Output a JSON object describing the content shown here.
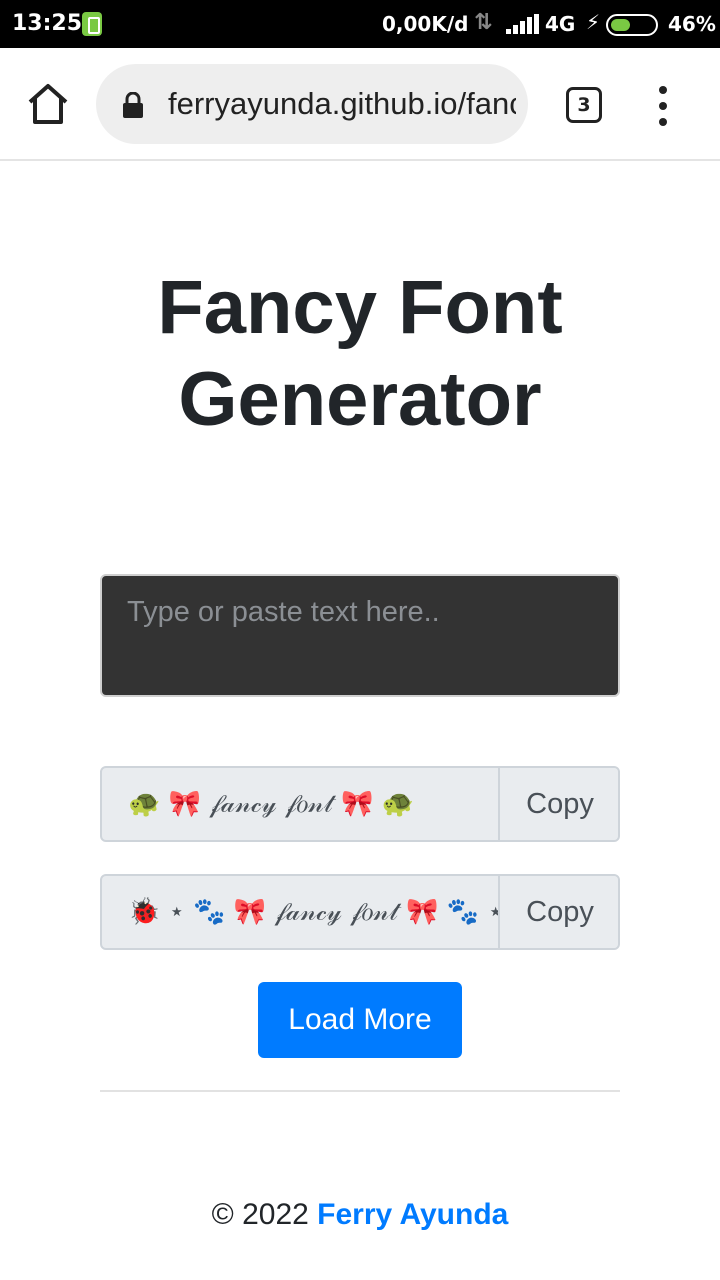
{
  "status_bar": {
    "time": "13:25",
    "net_speed": "0,00K/d",
    "network_type": "4G",
    "battery_percent": "46%",
    "battery_level": 0.46
  },
  "browser": {
    "url": "ferryayunda.github.io/fancy-font-generator",
    "tab_count": "3"
  },
  "page": {
    "title": "Fancy Font Generator",
    "input_placeholder": "Type or paste text here..",
    "results": [
      {
        "text": "🐢 🎀 𝒻𝒶𝓃𝒸𝓎 𝒻𝑜𝓃𝓉 🎀 🐢",
        "copy_label": "Copy"
      },
      {
        "text": "🐞 ⋆ 🐾 🎀 𝒻𝒶𝓃𝒸𝓎 𝒻𝑜𝓃𝓉 🎀 🐾 ⋆ 🐞",
        "copy_label": "Copy"
      }
    ],
    "load_more_label": "Load More",
    "footer_prefix": "© 2022",
    "footer_author": "Ferry Ayunda"
  }
}
